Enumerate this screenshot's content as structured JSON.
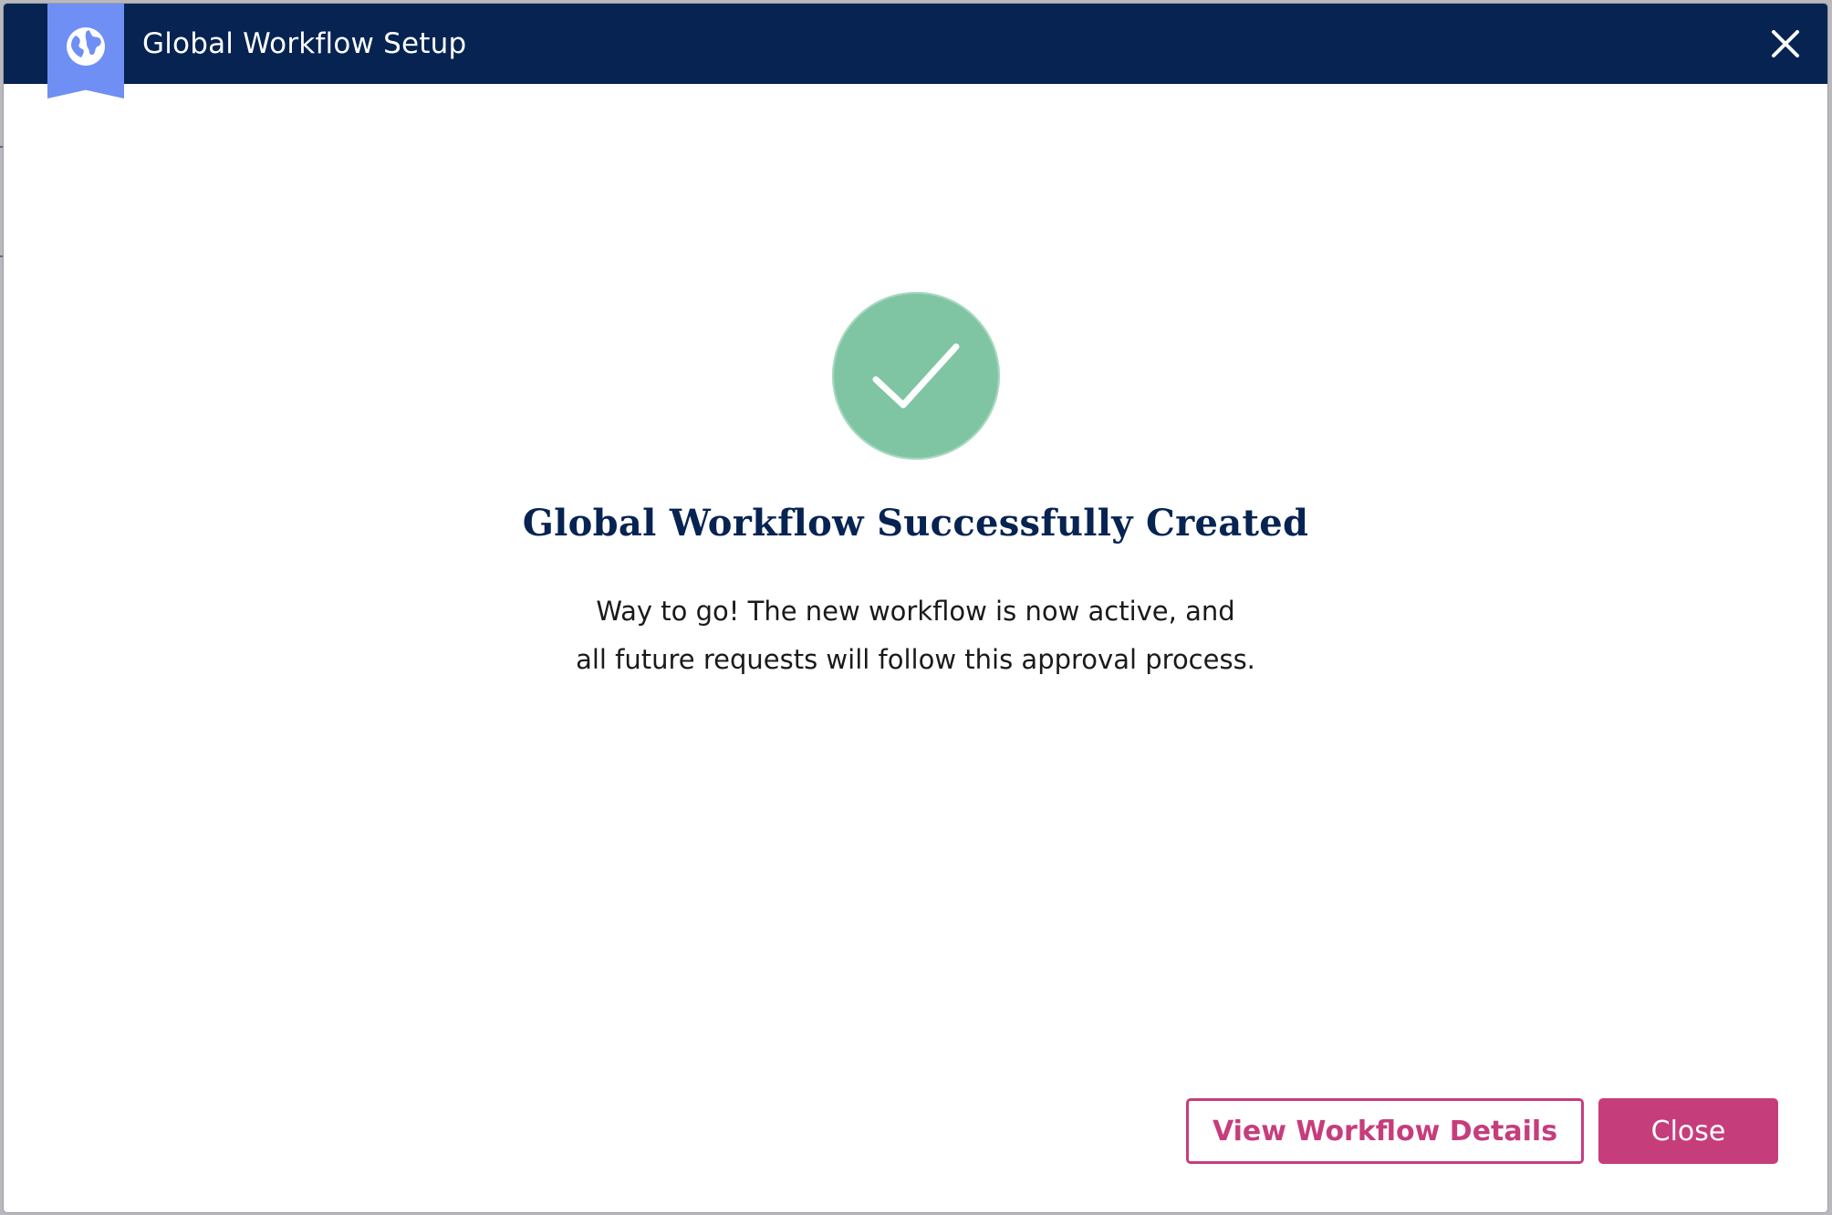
{
  "dialog": {
    "title": "Global Workflow Setup",
    "header_icon": "globe-icon",
    "close_icon": "close-icon"
  },
  "content": {
    "status_icon": "checkmark-icon",
    "heading": "Global Workflow Successfully Created",
    "message_line_1": "Way to go! The new workflow is now active, and",
    "message_line_2": "all future requests will follow this approval process."
  },
  "footer": {
    "secondary_button_label": "View Workflow Details",
    "primary_button_label": "Close"
  },
  "colors": {
    "header_bg": "#062352",
    "badge_bg": "#6f8ff4",
    "success_green": "#7fc5a4",
    "accent_pink": "#c63d7c"
  }
}
